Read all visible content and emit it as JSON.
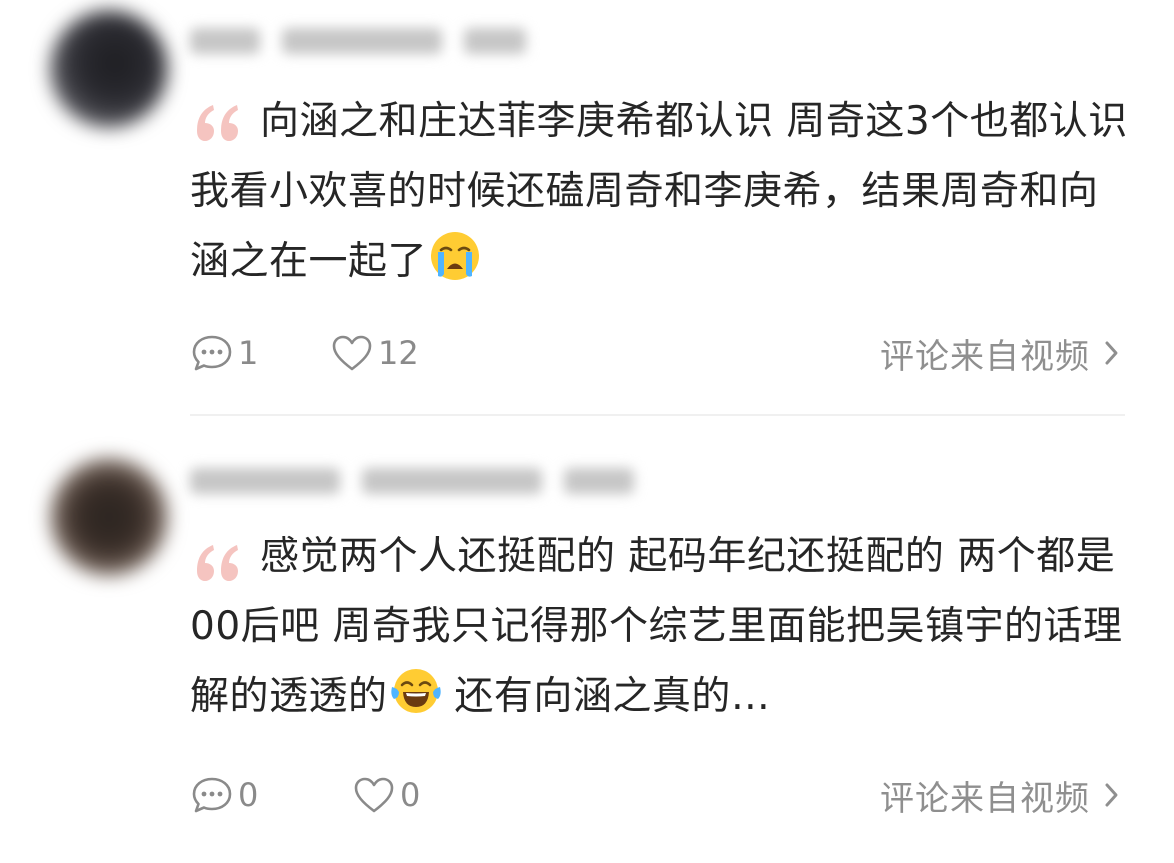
{
  "comments": [
    {
      "text": "向涵之和庄达菲李庚希都认识 周奇这3个也都认识 我看小欢喜的时候还磕周奇和李庚希，结果周奇和向涵之在一起了",
      "emoji": "loudly-crying-face",
      "reply_count": "1",
      "like_count": "12",
      "source_label": "评论来自视频"
    },
    {
      "text": "感觉两个人还挺配的 起码年纪还挺配的 两个都是00后吧 周奇我只记得那个综艺里面能把吴镇宇的话理解的透透的",
      "emoji": "face-with-tears-of-joy",
      "text_after_emoji": " 还有向涵之真的…",
      "reply_count": "0",
      "like_count": "0",
      "source_label": "评论来自视频"
    }
  ],
  "colors": {
    "quote_mark": "#f5c4c0",
    "text": "#262626",
    "muted": "#8a8a8a",
    "divider": "#f0f0f0"
  },
  "icons": [
    "quote-icon",
    "comment-bubble-icon",
    "heart-icon",
    "chevron-right-icon",
    "loudly-crying-face-emoji",
    "face-with-tears-of-joy-emoji"
  ]
}
